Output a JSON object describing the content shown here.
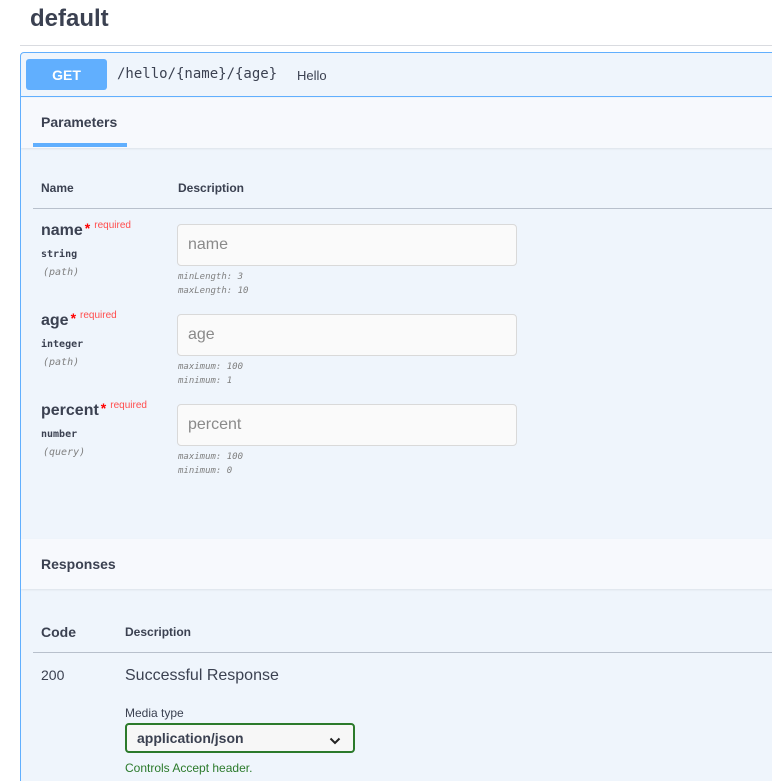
{
  "tag": {
    "title": "default"
  },
  "operation": {
    "method": "GET",
    "path": "/hello/{name}/{age}",
    "summary": "Hello"
  },
  "parameters": {
    "tab_label": "Parameters",
    "col_name": "Name",
    "col_description": "Description",
    "required_label": "required",
    "required_star": "*",
    "items": [
      {
        "name": "name",
        "type": "string",
        "in": "(path)",
        "placeholder": "name",
        "constraints": [
          "minLength: 3",
          "maxLength: 10"
        ]
      },
      {
        "name": "age",
        "type": "integer",
        "in": "(path)",
        "placeholder": "age",
        "constraints": [
          "maximum: 100",
          "minimum: 1"
        ]
      },
      {
        "name": "percent",
        "type": "number",
        "in": "(query)",
        "placeholder": "percent",
        "constraints": [
          "maximum: 100",
          "minimum: 0"
        ]
      }
    ]
  },
  "responses": {
    "title": "Responses",
    "col_code": "Code",
    "col_description": "Description",
    "items": [
      {
        "code": "200",
        "description": "Successful Response",
        "media_type_label": "Media type",
        "media_type": "application/json",
        "media_note": "Controls Accept header."
      }
    ]
  },
  "colors": {
    "get_accent": "#61affe",
    "block_bg": "#eff5fc",
    "required": "#ff0000",
    "media_border": "#2b7a2b"
  }
}
